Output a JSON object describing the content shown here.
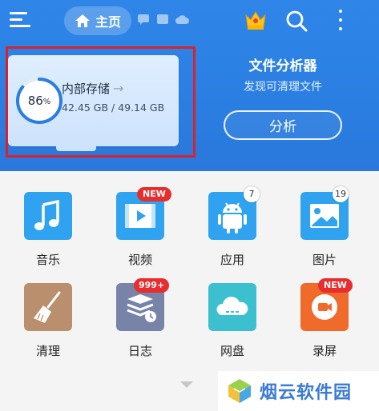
{
  "header": {
    "home_tab_label": "主页"
  },
  "storage": {
    "percent": "86",
    "percent_sign": "%",
    "percent_value": 86,
    "title": "内部存储",
    "arrow": "→",
    "sizes": "42.45 GB / 49.14 GB"
  },
  "analyzer": {
    "title": "文件分析器",
    "subtitle": "发现可清理文件",
    "button_label": "分析"
  },
  "grid": {
    "items": [
      {
        "label": "音乐",
        "icon": "music-icon",
        "color": "#2fa3f0"
      },
      {
        "label": "视频",
        "icon": "video-icon",
        "color": "#2fa3f0",
        "badge": "NEW"
      },
      {
        "label": "应用",
        "icon": "android-icon",
        "color": "#2fa3f0",
        "badge": "7"
      },
      {
        "label": "图片",
        "icon": "image-icon",
        "color": "#2fa3f0",
        "badge": "19"
      },
      {
        "label": "清理",
        "icon": "broom-icon",
        "color": "#b98f6d"
      },
      {
        "label": "日志",
        "icon": "log-icon",
        "color": "#7784a8",
        "badge": "999+"
      },
      {
        "label": "网盘",
        "icon": "cloud-icon",
        "color": "#3cc0cf"
      },
      {
        "label": "录屏",
        "icon": "record-icon",
        "color": "#f06a2c",
        "badge": "NEW"
      }
    ]
  },
  "watermark": {
    "text": "烟云软件园"
  },
  "colors": {
    "header_blue": "#2b7fe2",
    "highlight_red": "#d9222c",
    "badge_red": "#e72d2d"
  }
}
